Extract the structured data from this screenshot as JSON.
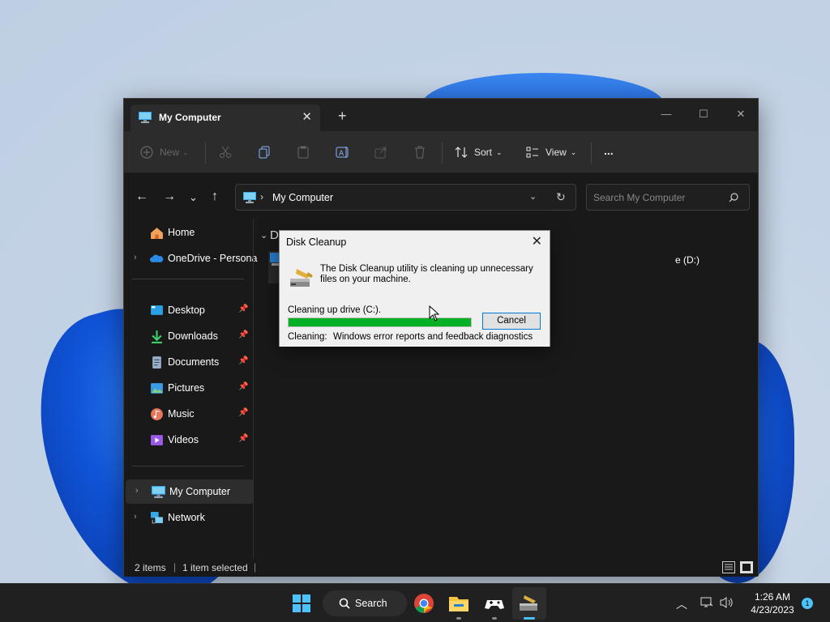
{
  "explorer": {
    "tab_title": "My Computer",
    "toolbar": {
      "new_label": "New",
      "sort_label": "Sort",
      "view_label": "View",
      "more_label": "..."
    },
    "address": {
      "path": "My Computer"
    },
    "search": {
      "placeholder": "Search My Computer"
    },
    "sidebar": {
      "home": "Home",
      "onedrive": "OneDrive - Persona",
      "desktop": "Desktop",
      "downloads": "Downloads",
      "documents": "Documents",
      "pictures": "Pictures",
      "music": "Music",
      "videos": "Videos",
      "my_computer": "My Computer",
      "network": "Network"
    },
    "content": {
      "group_header": "D",
      "drive_d_label": "e (D:)"
    },
    "status": {
      "items": "2 items",
      "selected": "1 item selected"
    }
  },
  "dialog": {
    "title": "Disk Cleanup",
    "message": "The Disk Cleanup utility is cleaning up unnecessary files on your machine.",
    "drive_text": "Cleaning up drive  (C:).",
    "progress": 1.0,
    "cancel_label": "Cancel",
    "cleaning_label": "Cleaning:",
    "cleaning_value": "Windows error reports and feedback diagnostics"
  },
  "taskbar": {
    "search_label": "Search",
    "time": "1:26 AM",
    "date": "4/23/2023",
    "notification_count": "1"
  },
  "colors": {
    "accent": "#0078d7",
    "progress": "#06b025",
    "notification": "#4cc2ff"
  }
}
